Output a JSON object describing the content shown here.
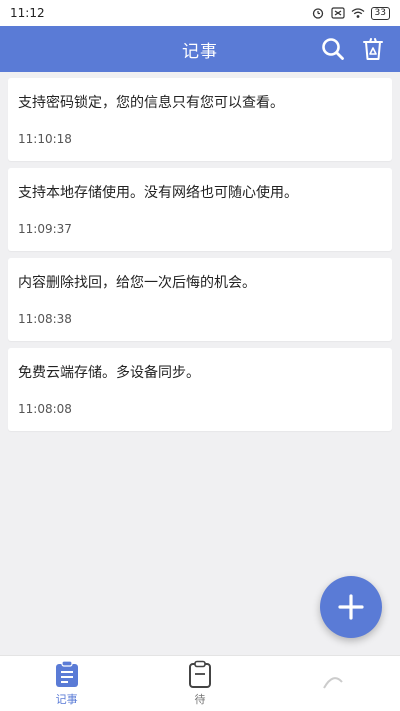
{
  "status_bar": {
    "time": "11:12",
    "battery": "33"
  },
  "app_bar": {
    "title": "记事"
  },
  "notes": [
    {
      "text": "支持密码锁定，您的信息只有您可以查看。",
      "time": "11:10:18"
    },
    {
      "text": "支持本地存储使用。没有网络也可随心使用。",
      "time": "11:09:37"
    },
    {
      "text": "内容删除找回，给您一次后悔的机会。",
      "time": "11:08:38"
    },
    {
      "text": "免费云端存储。多设备同步。",
      "time": "11:08:08"
    }
  ],
  "bottom_nav": {
    "items": [
      {
        "label": "记事",
        "icon": "notepad-icon",
        "active": true
      },
      {
        "label": "待",
        "icon": "clipboard-icon",
        "active": false
      },
      {
        "label": "",
        "icon": "more-icon",
        "active": false
      }
    ]
  },
  "colors": {
    "accent": "#5a7bd6",
    "background": "#f0f0f2"
  }
}
